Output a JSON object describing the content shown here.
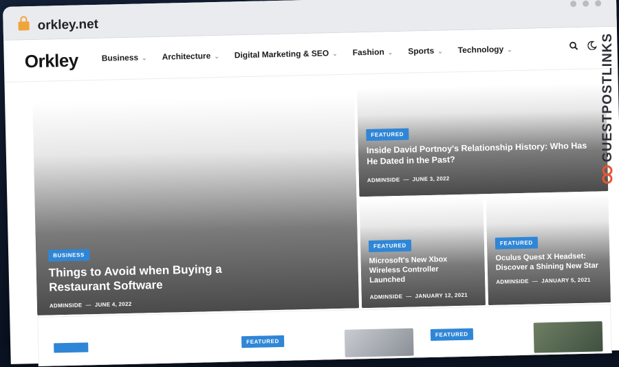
{
  "browser": {
    "url": "orkley.net"
  },
  "site": {
    "logo": "Orkley",
    "menu": [
      "Business",
      "Architecture",
      "Digital Marketing & SEO",
      "Fashion",
      "Sports",
      "Technology"
    ]
  },
  "hero": {
    "main": {
      "category": "BUSINESS",
      "title": "Things to Avoid when Buying a Restaurant Software",
      "author": "ADMINSIDE",
      "date": "JUNE 4, 2022"
    },
    "top_right": {
      "category": "FEATURED",
      "title": "Inside David Portnoy's Relationship History: Who Has He Dated in the Past?",
      "author": "ADMINSIDE",
      "date": "JUNE 3, 2022"
    },
    "bottom_left": {
      "category": "FEATURED",
      "title": "Microsoft's New Xbox Wireless Controller Launched",
      "author": "ADMINSIDE",
      "date": "JANUARY 12, 2021"
    },
    "bottom_right": {
      "category": "FEATURED",
      "title": "Oculus Quest X Headset: Discover a Shining New Star",
      "author": "ADMINSIDE",
      "date": "JANUARY 5, 2021"
    }
  },
  "row2": {
    "badge1": "FEATURED",
    "badge2": "FEATURED"
  },
  "watermark": {
    "text": "GUESTPOSTLINKS"
  },
  "colors": {
    "accent": "#2f86d6",
    "watermark_logo": "#e8552f"
  }
}
